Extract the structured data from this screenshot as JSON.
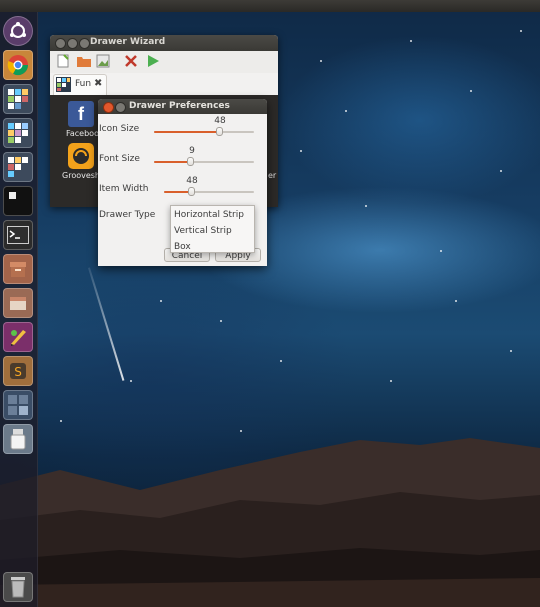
{
  "wizard": {
    "title": "Drawer Wizard",
    "tab_label": "Fun",
    "items": [
      {
        "label": "Facebook",
        "icon": "facebook-icon"
      },
      {
        "label": "Groovesha",
        "icon": "grooveshark-icon"
      }
    ],
    "right_partial_label": "er"
  },
  "preferences": {
    "title": "Drawer Preferences",
    "icon_size": {
      "label": "Icon Size",
      "value": "48"
    },
    "font_size": {
      "label": "Font Size",
      "value": "9"
    },
    "item_width": {
      "label": "Item Width",
      "value": "48"
    },
    "drawer_type": {
      "label": "Drawer Type"
    },
    "buttons": {
      "cancel": "Cancel",
      "apply": "Apply"
    }
  },
  "drawer_type_menu": {
    "options": [
      "Horizontal Strip",
      "Vertical Strip",
      "Box"
    ]
  },
  "colors": {
    "slider_fill": "#d95f2b",
    "titlebar": "#3e3d39",
    "launcher_bg": "#1e1c28"
  },
  "launcher": {
    "items": [
      "ubuntu-logo-icon",
      "chrome-icon",
      "drawer-icon",
      "drawer-icon",
      "drawer-icon",
      "drawer-icon",
      "terminal-icon",
      "archive-icon",
      "files-icon",
      "paint-icon",
      "sublime-text-icon",
      "workspace-switcher-icon",
      "usb-drive-icon",
      "trash-icon"
    ]
  }
}
